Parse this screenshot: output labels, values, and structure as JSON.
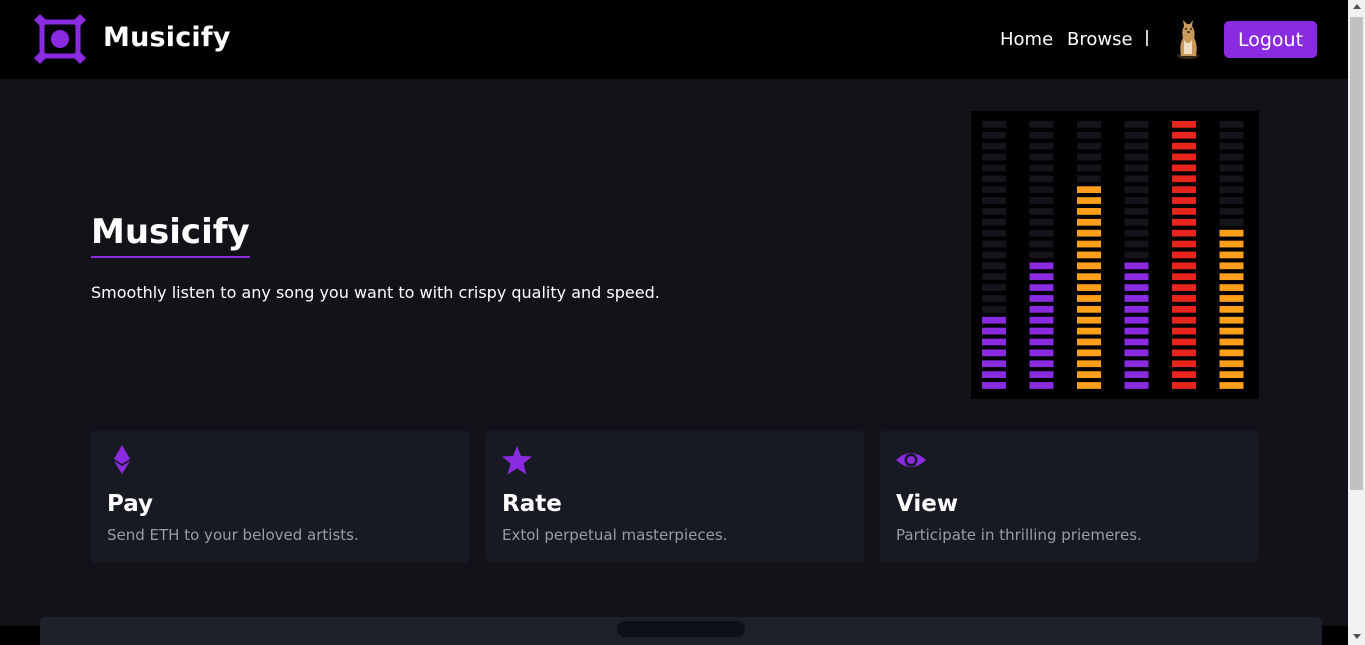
{
  "header": {
    "brand": "Musicify",
    "nav": {
      "home": "Home",
      "browse": "Browse"
    },
    "logout_label": "Logout",
    "accent": "#8a2be2"
  },
  "hero": {
    "title": "Musicify",
    "subtitle": "Smoothly listen to any song you want to with crispy quality and speed.",
    "equalizer": {
      "total_segments": 25,
      "bars": [
        {
          "lit": 7,
          "color": "#8a2be2"
        },
        {
          "lit": 12,
          "color": "#8a2be2"
        },
        {
          "lit": 19,
          "color": "#ff9f1c"
        },
        {
          "lit": 12,
          "color": "#8a2be2"
        },
        {
          "lit": 25,
          "color": "#e8241c"
        },
        {
          "lit": 15,
          "color": "#ff9f1c"
        }
      ]
    }
  },
  "features": [
    {
      "icon": "ethereum-icon",
      "title": "Pay",
      "description": "Send ETH to your beloved artists."
    },
    {
      "icon": "star-icon",
      "title": "Rate",
      "description": "Extol perpetual masterpieces."
    },
    {
      "icon": "eye-icon",
      "title": "View",
      "description": "Participate in thrilling priemeres."
    }
  ]
}
